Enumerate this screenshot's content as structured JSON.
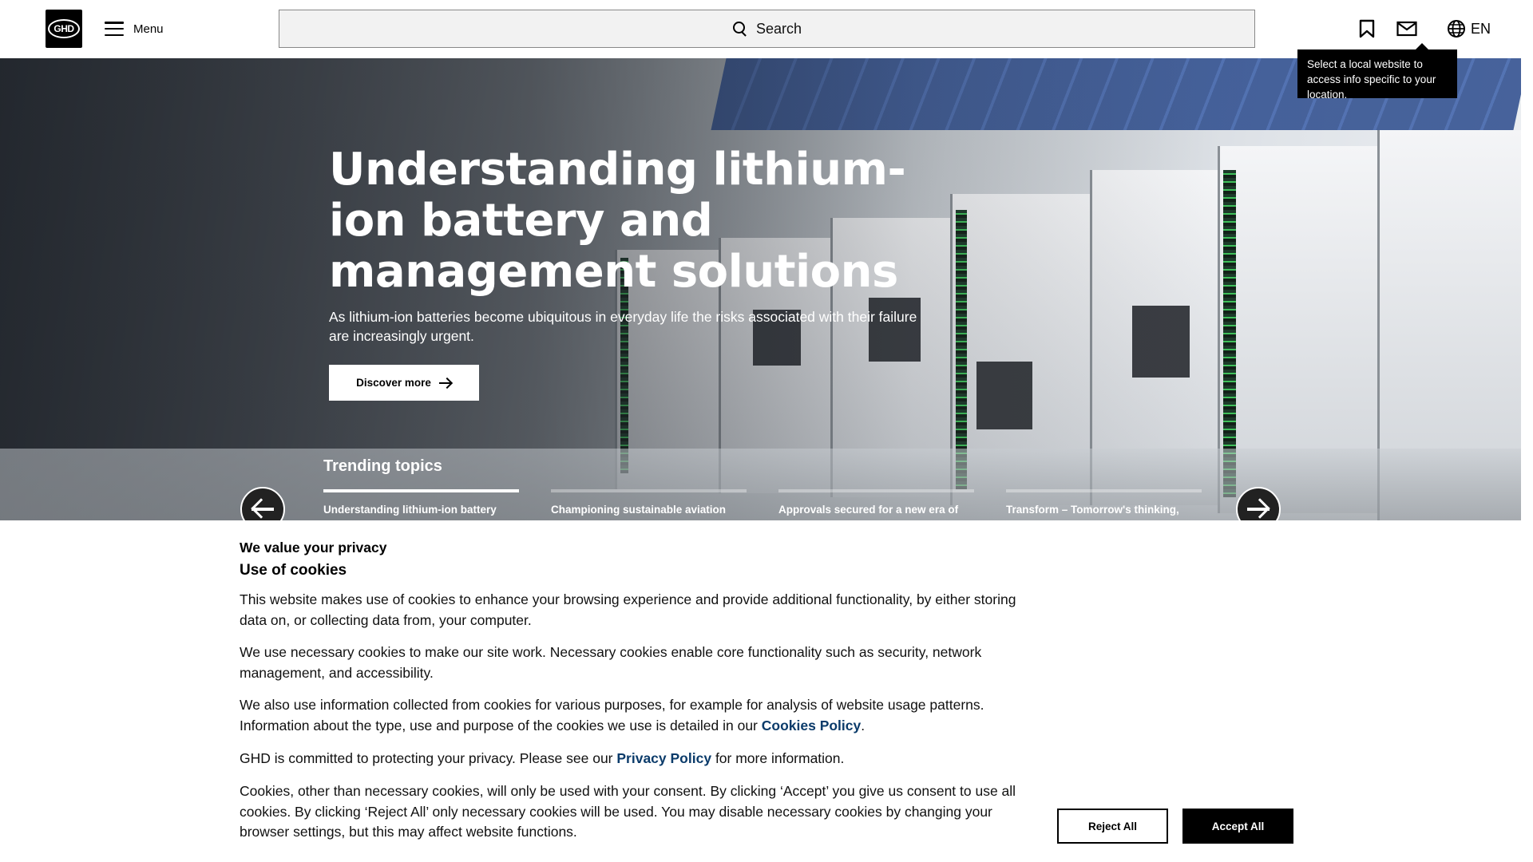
{
  "header": {
    "logo_text": "GHD",
    "menu_label": "Menu",
    "search_label": "Search",
    "lang_label": "EN",
    "icons": [
      "bookmark-icon",
      "mail-icon",
      "globe-icon",
      "search-icon",
      "hamburger-icon"
    ]
  },
  "tooltip": {
    "text": "Select a local website to access info specific to your location."
  },
  "hero": {
    "title": "Understanding lithium-ion battery and management solutions",
    "subtitle": "As lithium-ion batteries become ubiquitous in everyday life the risks associated with their failure are increasingly urgent.",
    "cta_label": "Discover more",
    "trending_heading": "Trending topics",
    "topics": [
      {
        "label": "Understanding lithium-ion battery",
        "active": true
      },
      {
        "label": "Championing sustainable aviation",
        "active": false
      },
      {
        "label": "Approvals secured for a new era of",
        "active": false
      },
      {
        "label": "Transform – Tomorrow's thinking,",
        "active": false
      }
    ]
  },
  "cookie": {
    "title": "We value your privacy",
    "subtitle": "Use of cookies",
    "p1": "This website makes use of cookies to enhance your browsing experience and provide additional functionality, by either storing data on, or collecting data from, your computer.",
    "p2": "We use necessary cookies to make our site work. Necessary cookies enable core functionality such as security, network management, and accessibility.",
    "p3_before": "We also use information collected from cookies for various purposes, for example for analysis of website usage patterns. Information about the type, use and purpose of the cookies we use is detailed in our ",
    "p3_link": "Cookies Policy",
    "p3_after": ".",
    "p4_before": "GHD is committed to protecting your privacy. Please see our ",
    "p4_link": "Privacy Policy",
    "p4_after": " for more information.",
    "p5": "Cookies, other than necessary cookies, will only be used with your consent. By clicking ‘Accept’ you give us consent to use all cookies. By clicking ‘Reject All’ only necessary cookies will be used. You may disable necessary cookies by changing your browser settings, but this may affect website functions.",
    "reject_label": "Reject All",
    "accept_label": "Accept All",
    "link_color": "#0b3b6a"
  }
}
